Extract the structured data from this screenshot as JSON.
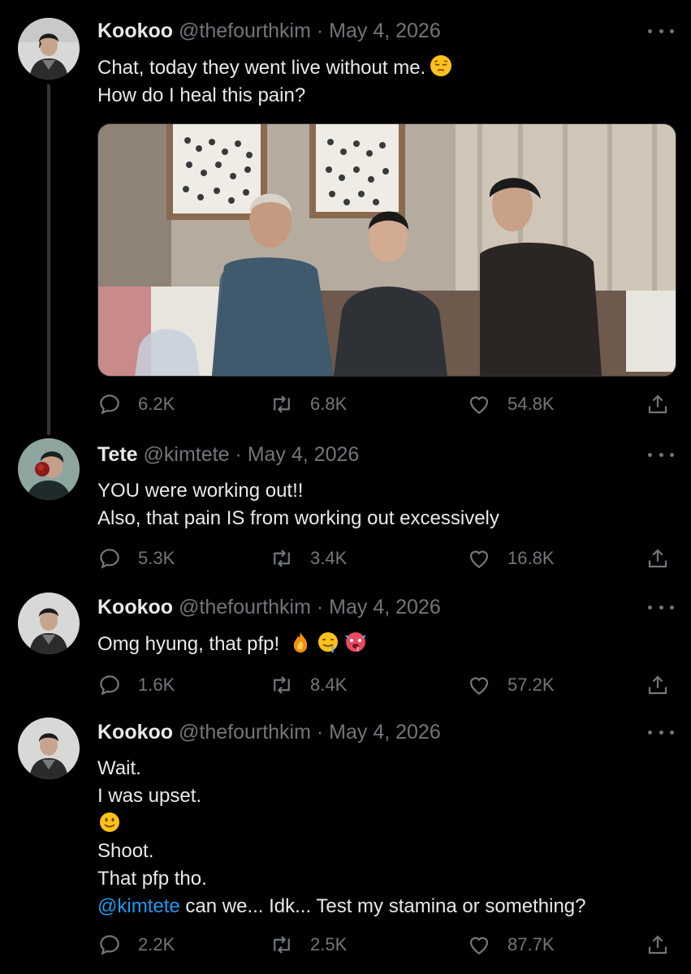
{
  "tweets": [
    {
      "name": "Kookoo",
      "meta": "@thefourthkim · May 4, 2026",
      "lines": [
        "Chat, today they went live without me.",
        "How do I heal this pain?"
      ],
      "reply": "6.2K",
      "retweet": "6.8K",
      "like": "54.8K"
    },
    {
      "name": "Tete",
      "meta": "@kimtete · May 4, 2026",
      "lines": [
        "YOU were working out!!",
        "Also, that pain IS from working out excessively"
      ],
      "reply": "5.3K",
      "retweet": "3.4K",
      "like": "16.8K"
    },
    {
      "name": "Kookoo",
      "meta": "@thefourthkim · May 4, 2026",
      "lines": [
        "Omg hyung, that pfp!"
      ],
      "reply": "1.6K",
      "retweet": "8.4K",
      "like": "57.2K"
    },
    {
      "name": "Kookoo",
      "meta": "@thefourthkim · May 4, 2026",
      "lines": [
        "Wait.",
        "I was upset.",
        "",
        "Shoot.",
        "That pfp tho."
      ],
      "mention": "@kimtete",
      "mention_rest": " can we... Idk... Test my stamina or something?",
      "reply": "2.2K",
      "retweet": "2.5K",
      "like": "87.7K"
    }
  ],
  "icons": {
    "reply": "reply-icon",
    "retweet": "retweet-icon",
    "like": "heart-icon",
    "share": "share-icon",
    "more": "more-icon"
  },
  "colors": {
    "background": "#000000",
    "text": "#e7e9ea",
    "muted": "#71767b",
    "link": "#1d9bf0",
    "line": "#333639"
  }
}
